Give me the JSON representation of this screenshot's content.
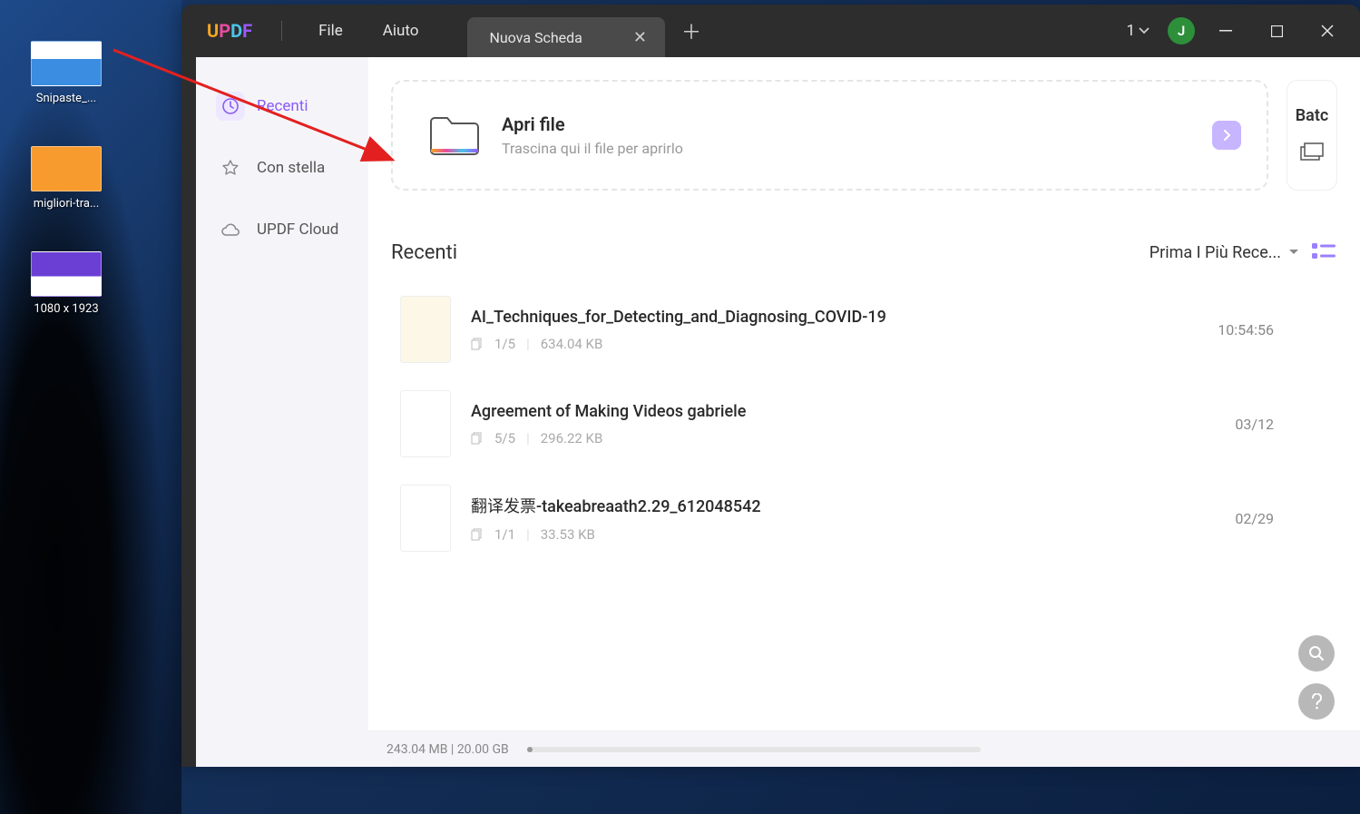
{
  "desktop": {
    "icons": [
      {
        "label": "Snipaste_..."
      },
      {
        "label": "migliori-tra..."
      },
      {
        "label": "1080 x 1923"
      }
    ]
  },
  "titlebar": {
    "menu_file": "File",
    "menu_help": "Aiuto",
    "tab_title": "Nuova Scheda",
    "count": "1",
    "avatar_initial": "J"
  },
  "sidebar": {
    "items": [
      {
        "label": "Recenti"
      },
      {
        "label": "Con stella"
      },
      {
        "label": "UPDF Cloud"
      }
    ]
  },
  "open_card": {
    "title": "Apri file",
    "subtitle": "Trascina qui il file per aprirlo"
  },
  "batch_card": {
    "label": "Batc"
  },
  "recent": {
    "title": "Recenti",
    "sort_label": "Prima I Più Rece...",
    "files": [
      {
        "name": "AI_Techniques_for_Detecting_and_Diagnosing_COVID-19",
        "pages": "1/5",
        "size": "634.04 KB",
        "time": "10:54:56"
      },
      {
        "name": "Agreement of Making Videos gabriele",
        "pages": "5/5",
        "size": "296.22 KB",
        "time": "03/12"
      },
      {
        "name": "翻译发票-takeabreaath2.29_612048542",
        "pages": "1/1",
        "size": "33.53 KB",
        "time": "02/29"
      }
    ]
  },
  "footer": {
    "storage": "243.04 MB | 20.00 GB"
  }
}
